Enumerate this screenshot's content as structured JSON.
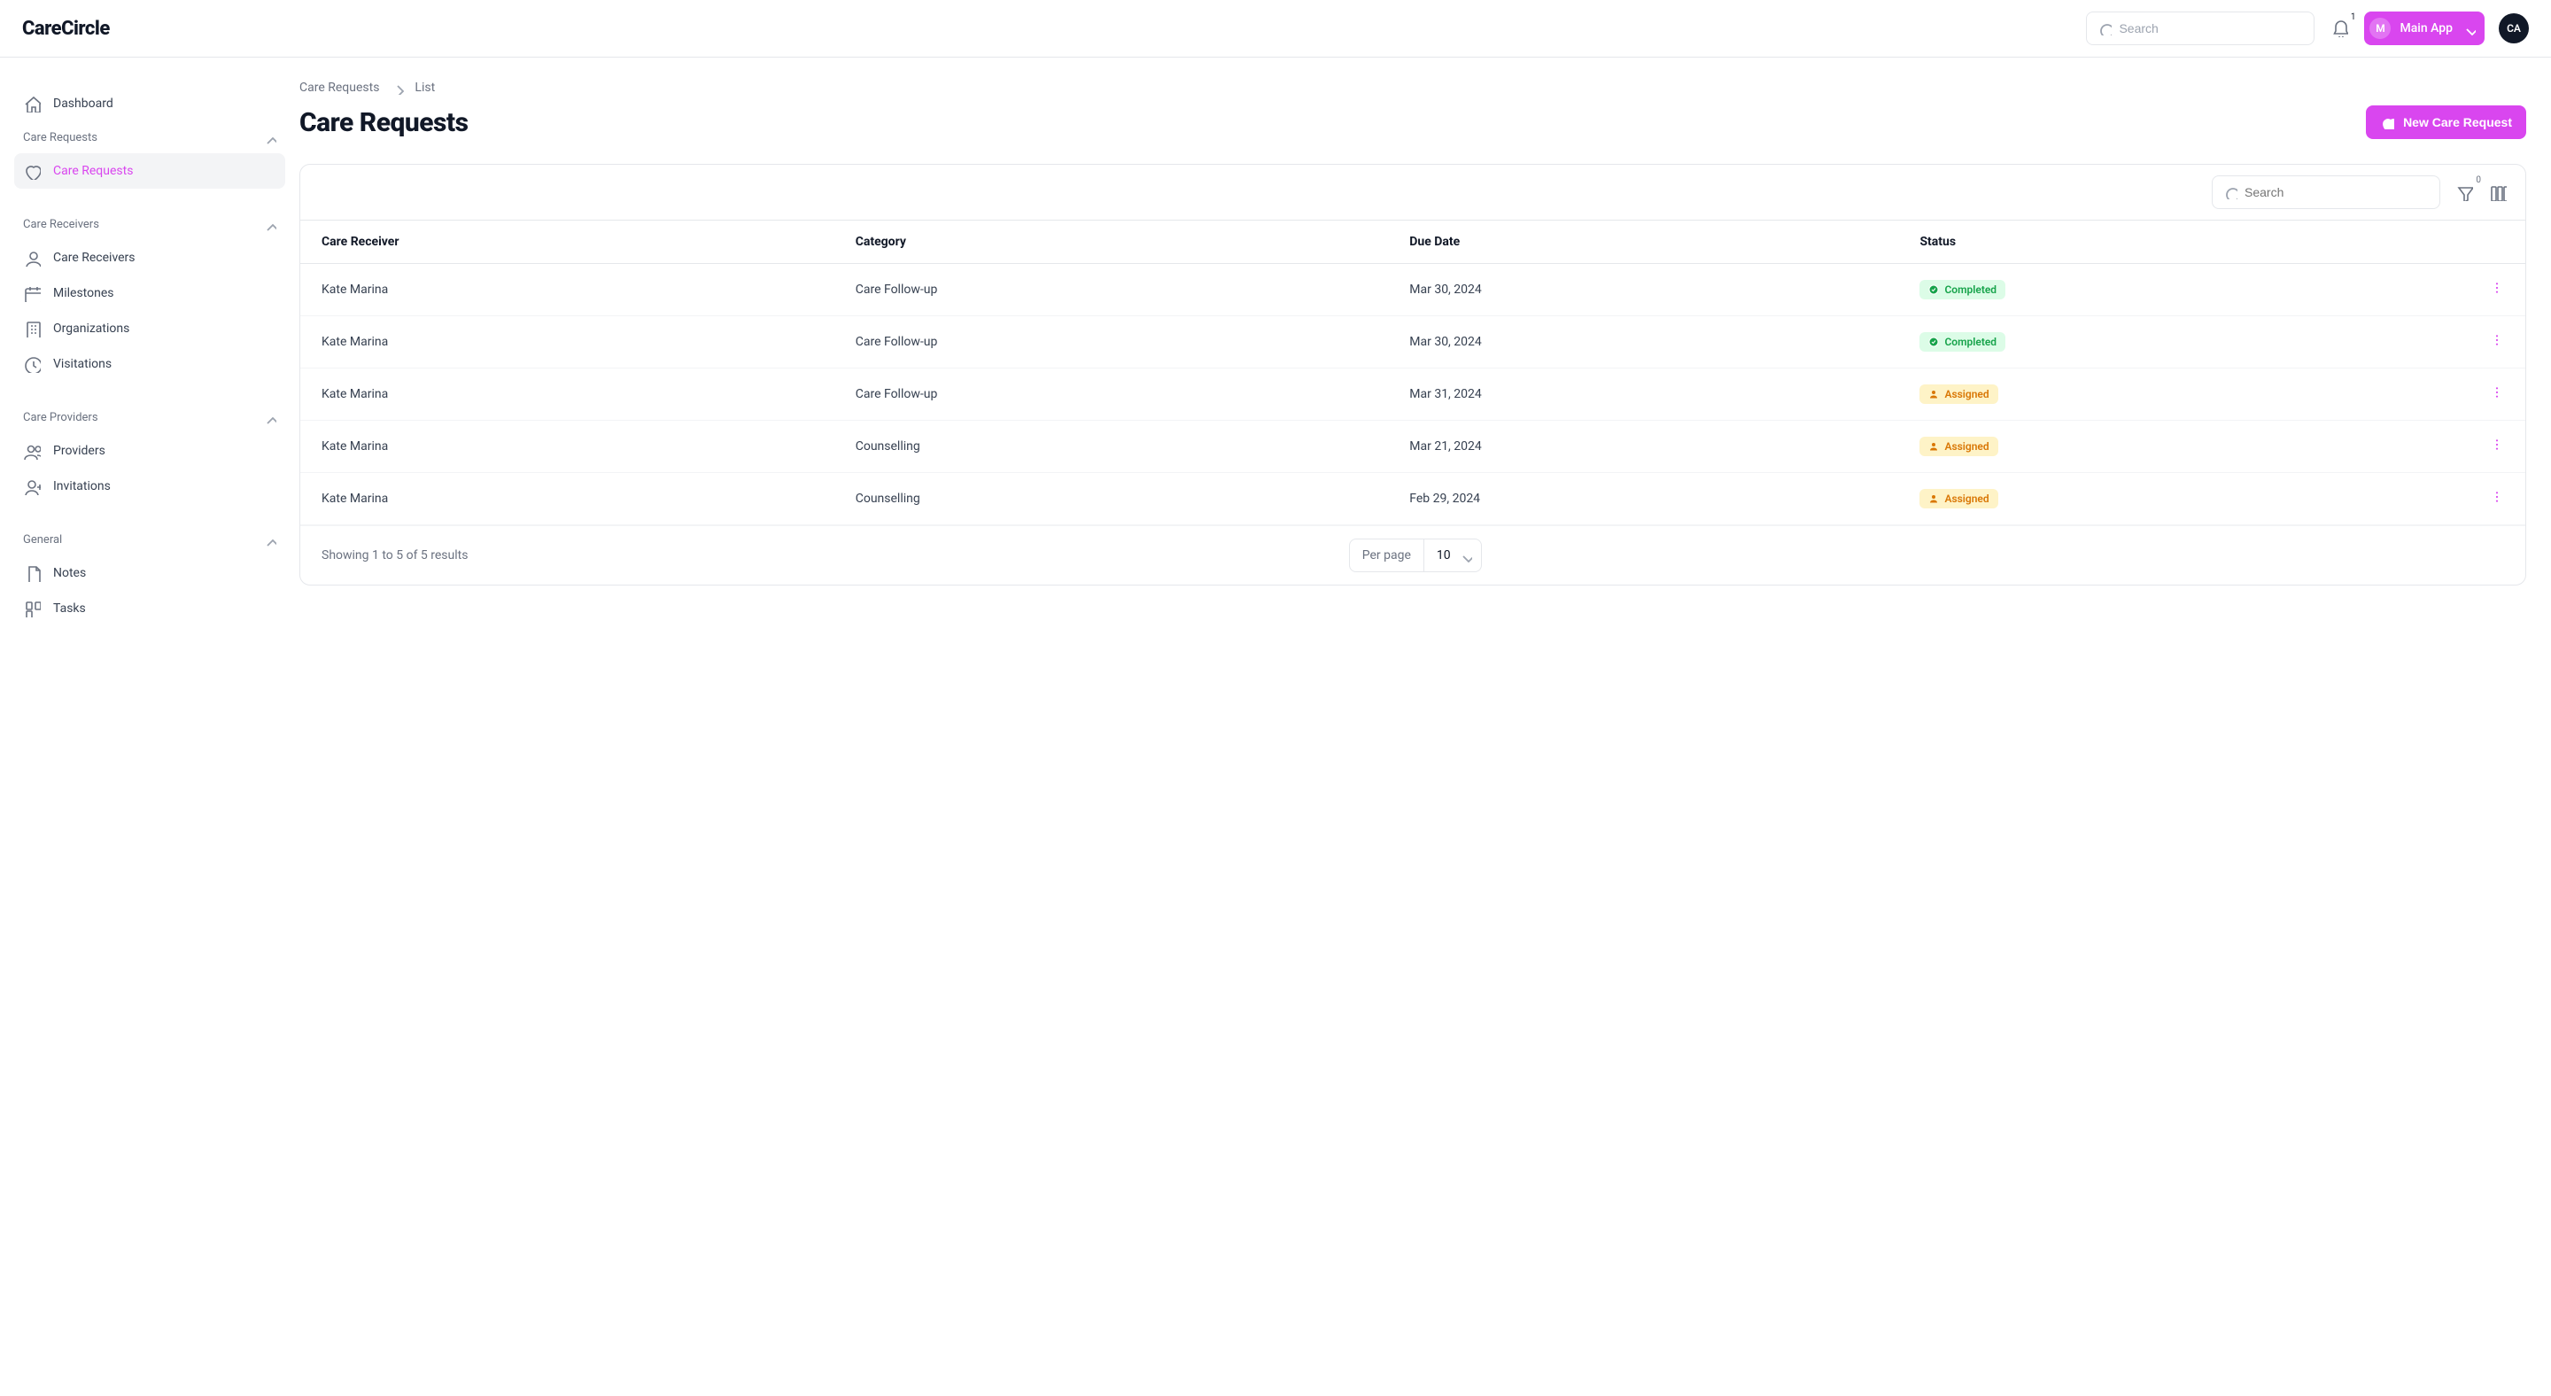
{
  "brand": "CareCircle",
  "header": {
    "search_placeholder": "Search",
    "bell_count": "1",
    "app_switch_initial": "M",
    "app_switch_label": "Main App",
    "avatar_initials": "CA"
  },
  "sidebar": {
    "dashboard_label": "Dashboard",
    "sections": [
      {
        "label": "Care Requests",
        "items": [
          {
            "label": "Care Requests",
            "icon": "heart",
            "active": true
          }
        ]
      },
      {
        "label": "Care Receivers",
        "items": [
          {
            "label": "Care Receivers",
            "icon": "user"
          },
          {
            "label": "Milestones",
            "icon": "calendar"
          },
          {
            "label": "Organizations",
            "icon": "building"
          },
          {
            "label": "Visitations",
            "icon": "clock"
          }
        ]
      },
      {
        "label": "Care Providers",
        "items": [
          {
            "label": "Providers",
            "icon": "users"
          },
          {
            "label": "Invitations",
            "icon": "user-plus"
          }
        ]
      },
      {
        "label": "General",
        "items": [
          {
            "label": "Notes",
            "icon": "doc"
          },
          {
            "label": "Tasks",
            "icon": "tasks"
          }
        ]
      }
    ]
  },
  "breadcrumb": {
    "parent": "Care Requests",
    "current": "List"
  },
  "page": {
    "title": "Care Requests",
    "new_button": "New Care Request"
  },
  "table": {
    "search_placeholder": "Search",
    "filter_count": "0",
    "columns": [
      "Care Receiver",
      "Category",
      "Due Date",
      "Status"
    ],
    "rows": [
      {
        "receiver": "Kate Marina",
        "category": "Care Follow-up",
        "due": "Mar 30, 2024",
        "status": "Completed",
        "status_kind": "completed"
      },
      {
        "receiver": "Kate Marina",
        "category": "Care Follow-up",
        "due": "Mar 30, 2024",
        "status": "Completed",
        "status_kind": "completed"
      },
      {
        "receiver": "Kate Marina",
        "category": "Care Follow-up",
        "due": "Mar 31, 2024",
        "status": "Assigned",
        "status_kind": "assigned"
      },
      {
        "receiver": "Kate Marina",
        "category": "Counselling",
        "due": "Mar 21, 2024",
        "status": "Assigned",
        "status_kind": "assigned"
      },
      {
        "receiver": "Kate Marina",
        "category": "Counselling",
        "due": "Feb 29, 2024",
        "status": "Assigned",
        "status_kind": "assigned"
      }
    ],
    "footer": {
      "showing": "Showing 1 to 5 of 5 results",
      "per_page_label": "Per page",
      "per_page_value": "10"
    }
  },
  "colors": {
    "accent": "#d946ef"
  }
}
